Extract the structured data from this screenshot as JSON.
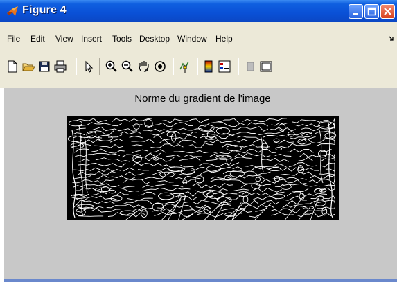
{
  "window": {
    "title": "Figure 4",
    "controls": [
      "minimize",
      "maximize",
      "close"
    ]
  },
  "menu": {
    "items": [
      "File",
      "Edit",
      "View",
      "Insert",
      "Tools",
      "Desktop",
      "Window",
      "Help"
    ]
  },
  "toolbar": {
    "icons": [
      "new-file-icon",
      "open-folder-icon",
      "save-icon",
      "print-icon",
      "pointer-icon",
      "zoom-in-icon",
      "zoom-out-icon",
      "pan-hand-icon",
      "rotate-3d-icon",
      "data-cursor-icon",
      "colorbar-icon",
      "legend-icon",
      "hide-plot-tools-icon",
      "show-plot-tools-icon"
    ]
  },
  "figure": {
    "title": "Norme du gradient de l'image",
    "image_content": "edge-detection-output",
    "colors": {
      "background": "#c8c8c8",
      "image_bg": "#000000",
      "edges": "#ffffff"
    }
  },
  "colors": {
    "titlebar": "#0a50d6",
    "menubar": "#ece9d8"
  }
}
